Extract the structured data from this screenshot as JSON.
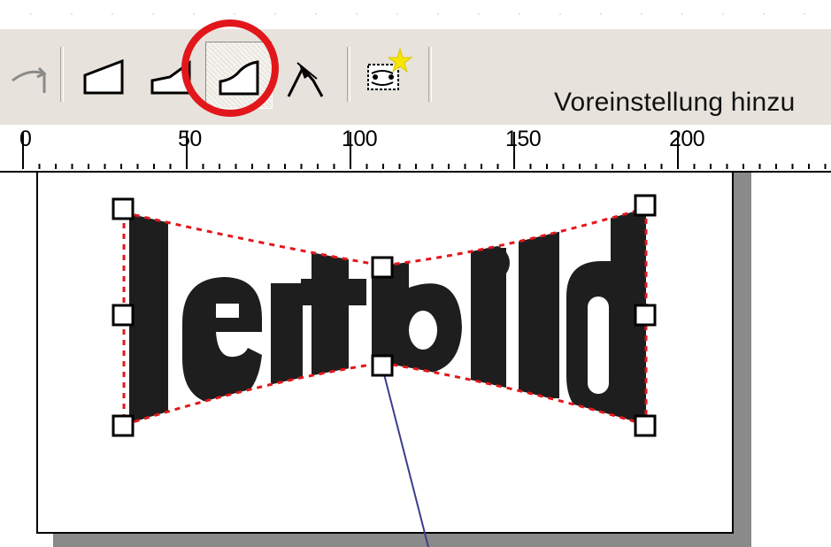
{
  "toolbar": {
    "buttons": [
      {
        "icon": "curved-arrow-icon",
        "active": false
      },
      {
        "icon": "slant-shape-icon",
        "active": false
      },
      {
        "icon": "perspective-shape-icon",
        "active": false
      },
      {
        "icon": "curved-envelope-icon",
        "active": true
      },
      {
        "icon": "node-curve-icon",
        "active": false
      },
      {
        "icon": "preset-sparkle-icon",
        "active": false
      }
    ],
    "preset_label": "Voreinstellung hinzu"
  },
  "ruler": {
    "labels": [
      "0",
      "50",
      "100",
      "150",
      "200"
    ]
  },
  "canvas": {
    "text": "leitbild",
    "text_color": "#1e1e1e"
  },
  "highlight": {
    "color": "#e2171b",
    "target": "curved-envelope-icon"
  }
}
